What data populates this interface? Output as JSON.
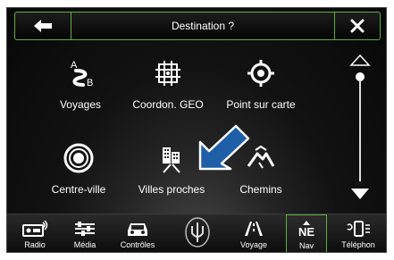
{
  "header": {
    "title": "Destination ?",
    "back_icon": "back-arrow-icon",
    "close_icon": "close-icon"
  },
  "menu": {
    "items": [
      {
        "label": "Voyages",
        "icon": "trips-icon"
      },
      {
        "label": "Coordon. GEO",
        "icon": "coordinates-icon"
      },
      {
        "label": "Point sur carte",
        "icon": "map-point-icon"
      },
      {
        "label": "Centre-ville",
        "icon": "city-center-icon"
      },
      {
        "label": "Villes proches",
        "icon": "nearby-cities-icon"
      },
      {
        "label": "Chemins",
        "icon": "roads-icon"
      }
    ],
    "icon_text": {
      "trip_a": "A",
      "trip_b": "B"
    }
  },
  "bottom_bar": {
    "items": [
      {
        "label": "Radio",
        "icon": "radio-icon"
      },
      {
        "label": "Média",
        "icon": "media-icon"
      },
      {
        "label": "Contrôles",
        "icon": "controls-icon"
      },
      {
        "label": "",
        "icon": "maserati-logo-icon"
      },
      {
        "label": "Voyage",
        "icon": "voyage-icon"
      },
      {
        "label": "Nav",
        "icon": "nav-compass-icon",
        "compass": "NE"
      },
      {
        "label": "Téléphon",
        "icon": "phone-icon"
      }
    ]
  },
  "colors": {
    "accent": "#5fae3e",
    "pointer": "#1f5fa8"
  }
}
